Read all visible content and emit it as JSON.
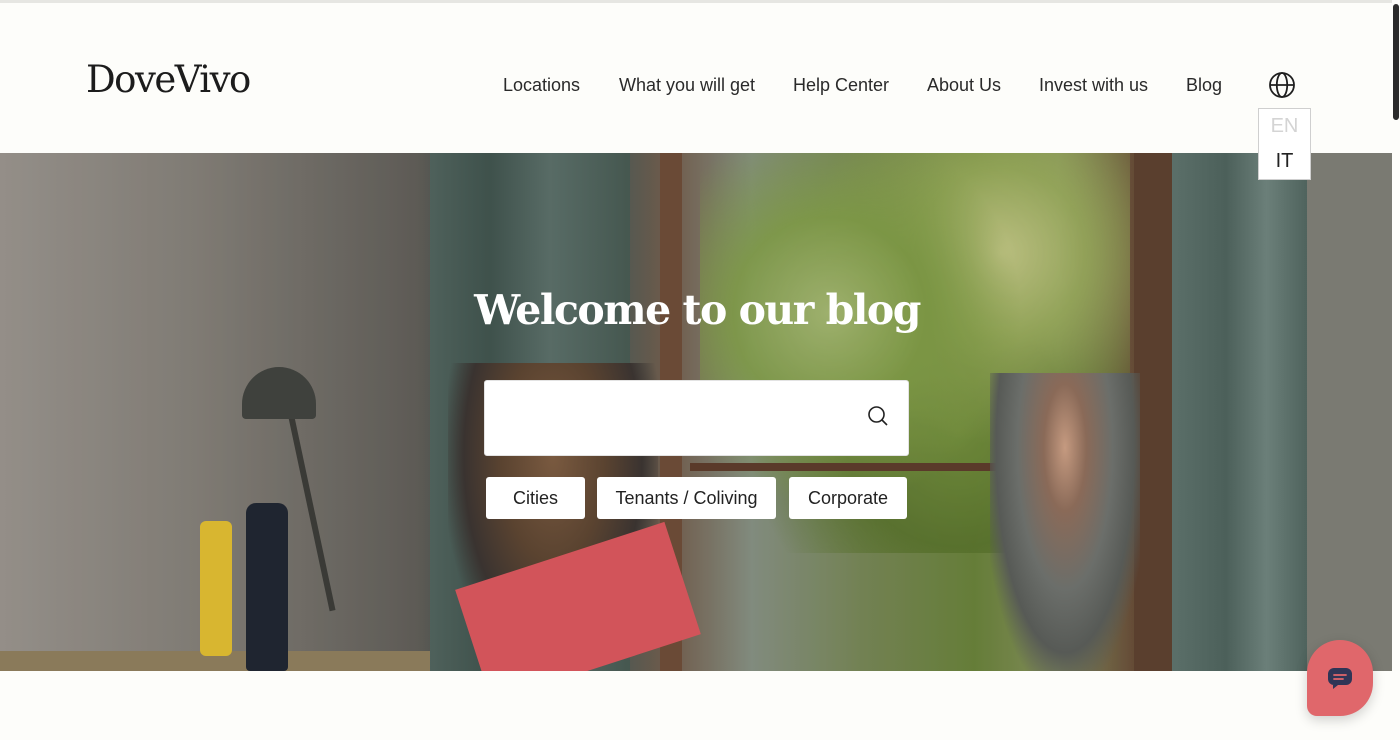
{
  "brand": {
    "logo": "DoveVivo"
  },
  "nav": {
    "items": [
      {
        "label": "Locations"
      },
      {
        "label": "What you will get"
      },
      {
        "label": "Help Center"
      },
      {
        "label": "About Us"
      },
      {
        "label": "Invest with us"
      },
      {
        "label": "Blog"
      }
    ],
    "language_icon": "globe-icon"
  },
  "language_menu": {
    "options": [
      {
        "label": "EN",
        "state": "disabled"
      },
      {
        "label": "IT",
        "state": "enabled"
      }
    ]
  },
  "hero": {
    "title": "Welcome to our blog",
    "search": {
      "value": "",
      "placeholder": "",
      "icon": "search-icon"
    },
    "categories": [
      {
        "label": "Cities"
      },
      {
        "label": "Tenants / Coliving"
      },
      {
        "label": "Corporate"
      }
    ]
  },
  "chat": {
    "icon": "chat-icon",
    "color": "#e0676b"
  },
  "colors": {
    "accent": "#e0676b",
    "background": "#fdfdfa"
  }
}
